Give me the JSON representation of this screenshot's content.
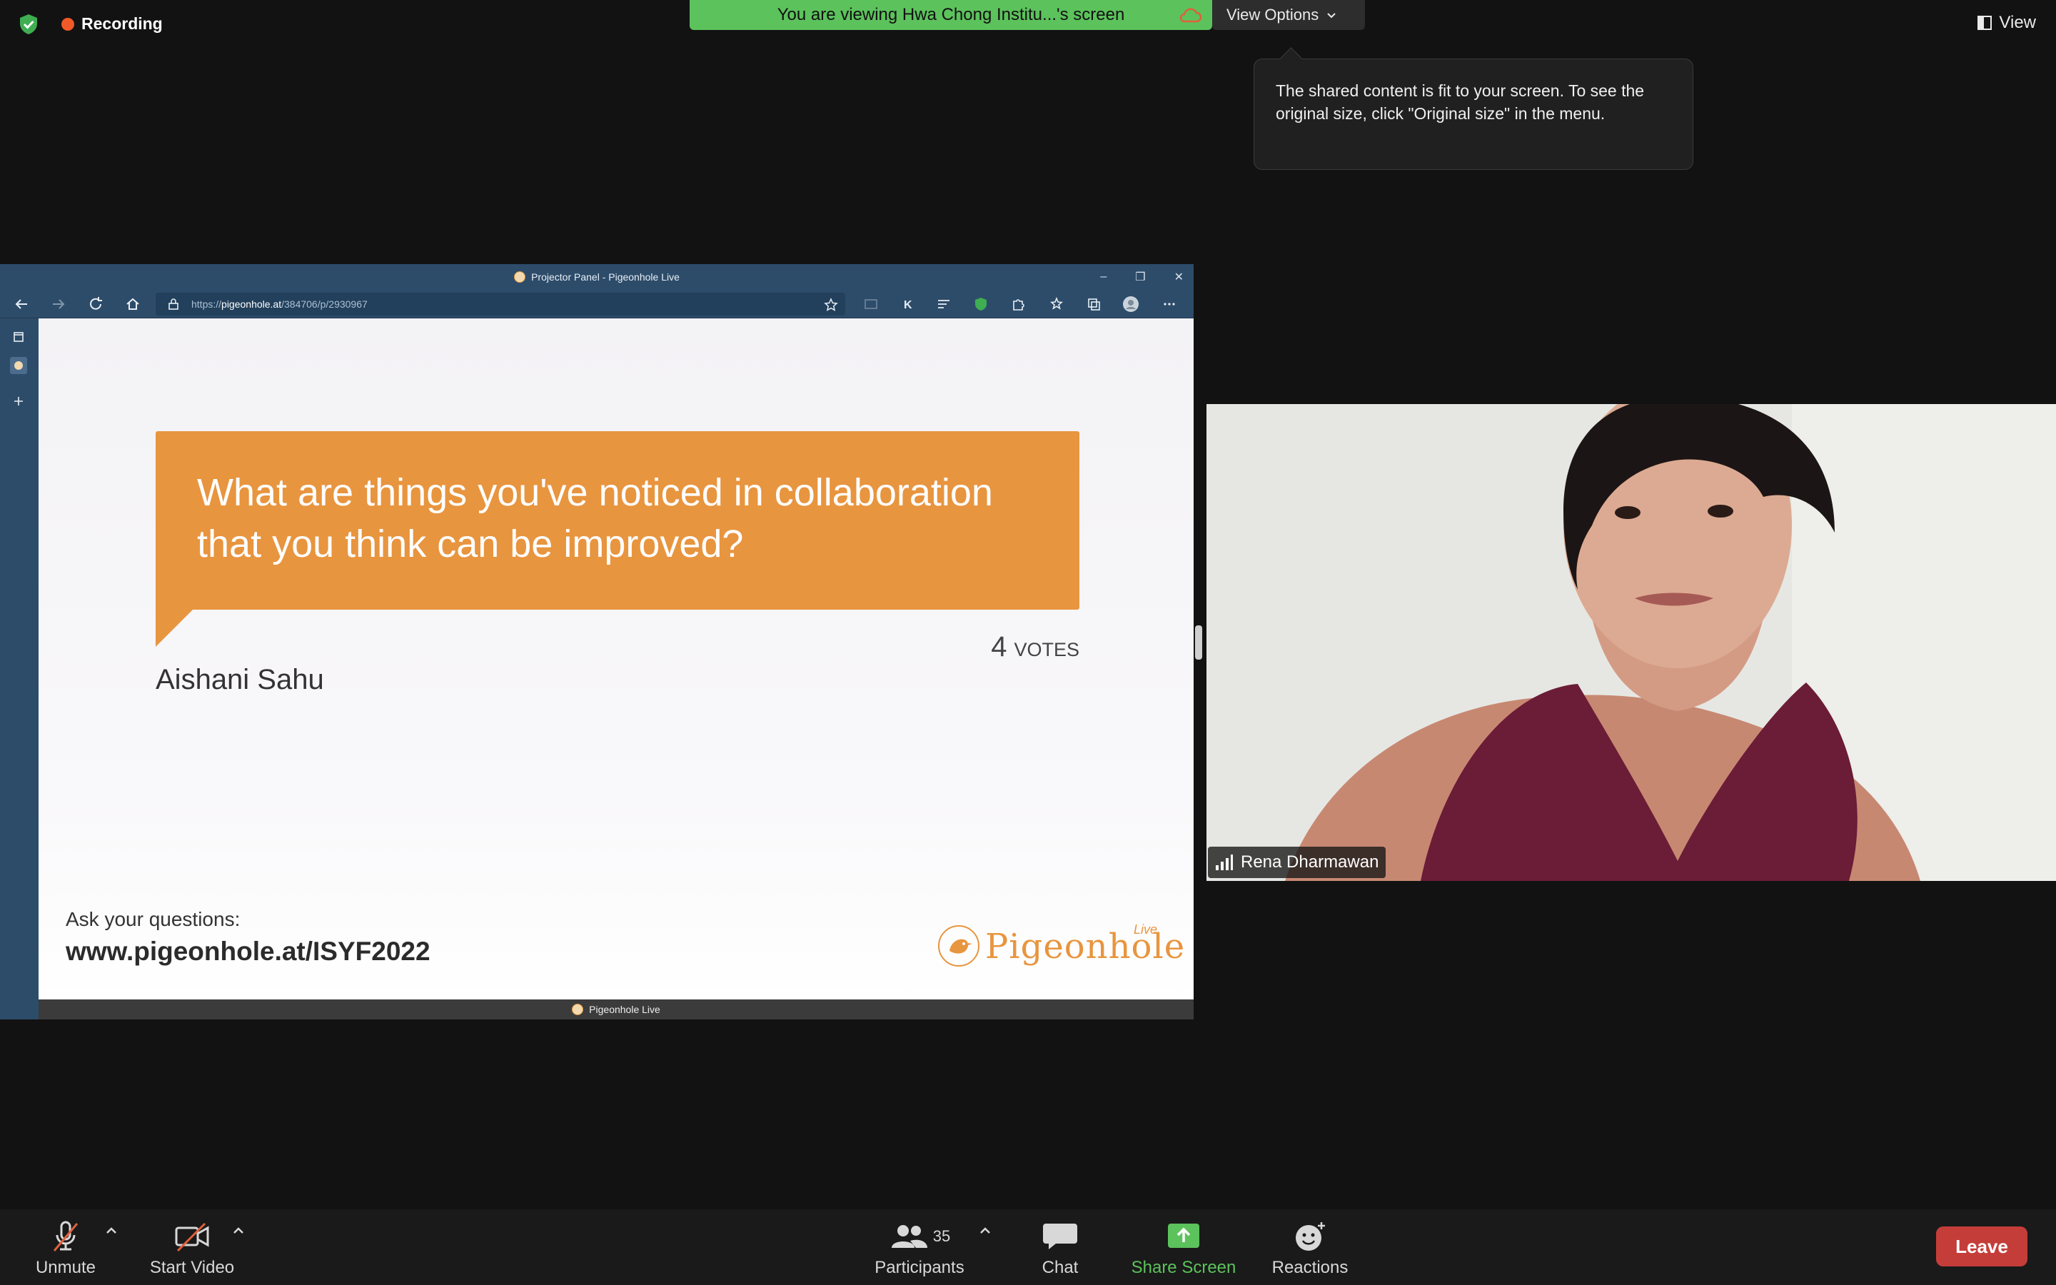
{
  "topbar": {
    "recording_label": "Recording",
    "viewing_banner": "You are viewing Hwa Chong Institu...'s screen",
    "view_options_label": "View Options",
    "view_label": "View"
  },
  "tooltip": {
    "text": "The shared content is fit to your screen. To see the original size, click \"Original size\" in the menu."
  },
  "browser": {
    "window_title": "Projector Panel - Pigeonhole Live",
    "url_prefix": "https://",
    "url_host": "pigeonhole.at",
    "url_path": "/384706/p/2930967",
    "status_text": "Pigeonhole Live"
  },
  "slide": {
    "question": "What are things you've noticed in collaboration that you think can be improved?",
    "votes_count": "4",
    "votes_label": "VOTES",
    "author": "Aishani Sahu",
    "ask_label": "Ask your questions:",
    "ask_url": "www.pigeonhole.at/ISYF2022",
    "logo_text": "Pigeonhole",
    "logo_sup": "Live",
    "accent_color": "#e8953f"
  },
  "video": {
    "participant_name": "Rena Dharmawan"
  },
  "toolbar": {
    "unmute_label": "Unmute",
    "start_video_label": "Start Video",
    "participants_label": "Participants",
    "participants_count": "35",
    "chat_label": "Chat",
    "share_screen_label": "Share Screen",
    "reactions_label": "Reactions",
    "leave_label": "Leave"
  }
}
